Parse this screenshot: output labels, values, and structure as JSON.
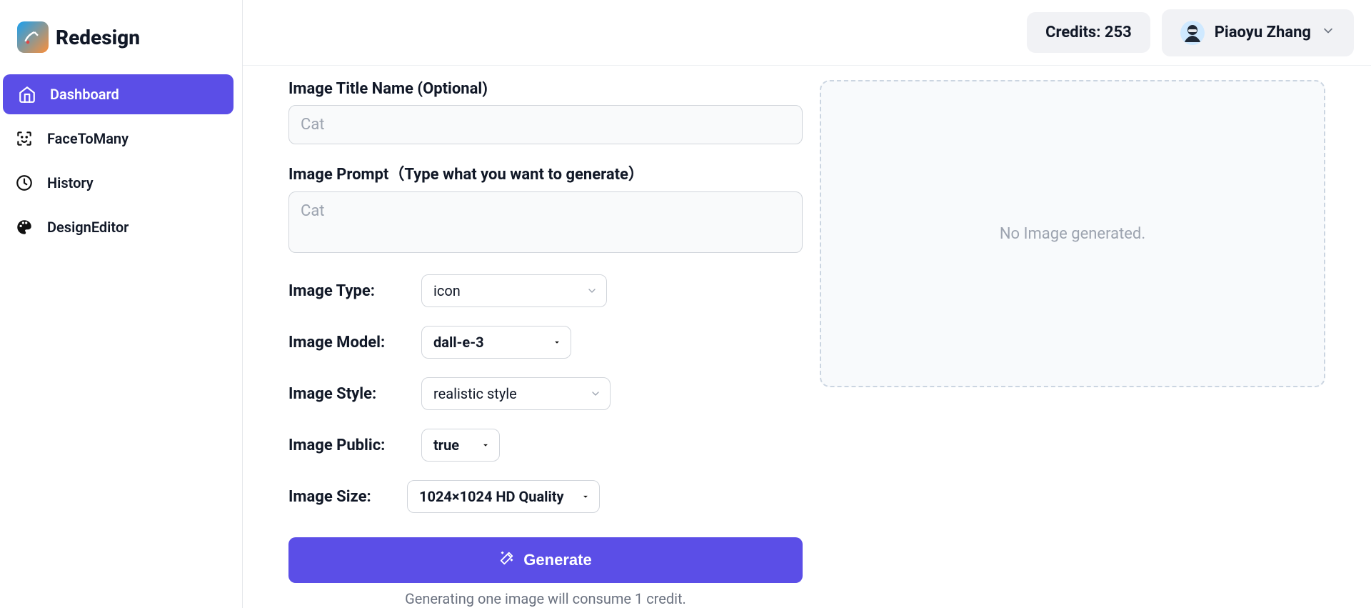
{
  "brand": {
    "name": "Redesign"
  },
  "sidebar": {
    "items": [
      {
        "label": "Dashboard"
      },
      {
        "label": "FaceToMany"
      },
      {
        "label": "History"
      },
      {
        "label": "DesignEditor"
      }
    ]
  },
  "topbar": {
    "credits_label": "Credits: 253",
    "user_name": "Piaoyu Zhang"
  },
  "form": {
    "title_label": "Image Title Name (Optional)",
    "title_placeholder": "Cat",
    "prompt_label": "Image Prompt（Type what you want to generate）",
    "prompt_placeholder": "Cat",
    "type_label": "Image Type:",
    "type_value": "icon",
    "model_label": "Image Model:",
    "model_value": "dall-e-3",
    "style_label": "Image Style:",
    "style_value": "realistic style",
    "public_label": "Image Public:",
    "public_value": "true",
    "size_label": "Image Size:",
    "size_value": "1024×1024 HD Quality",
    "generate_label": "Generate",
    "generate_note": "Generating one image will consume 1 credit."
  },
  "preview": {
    "empty_text": "No Image generated."
  }
}
